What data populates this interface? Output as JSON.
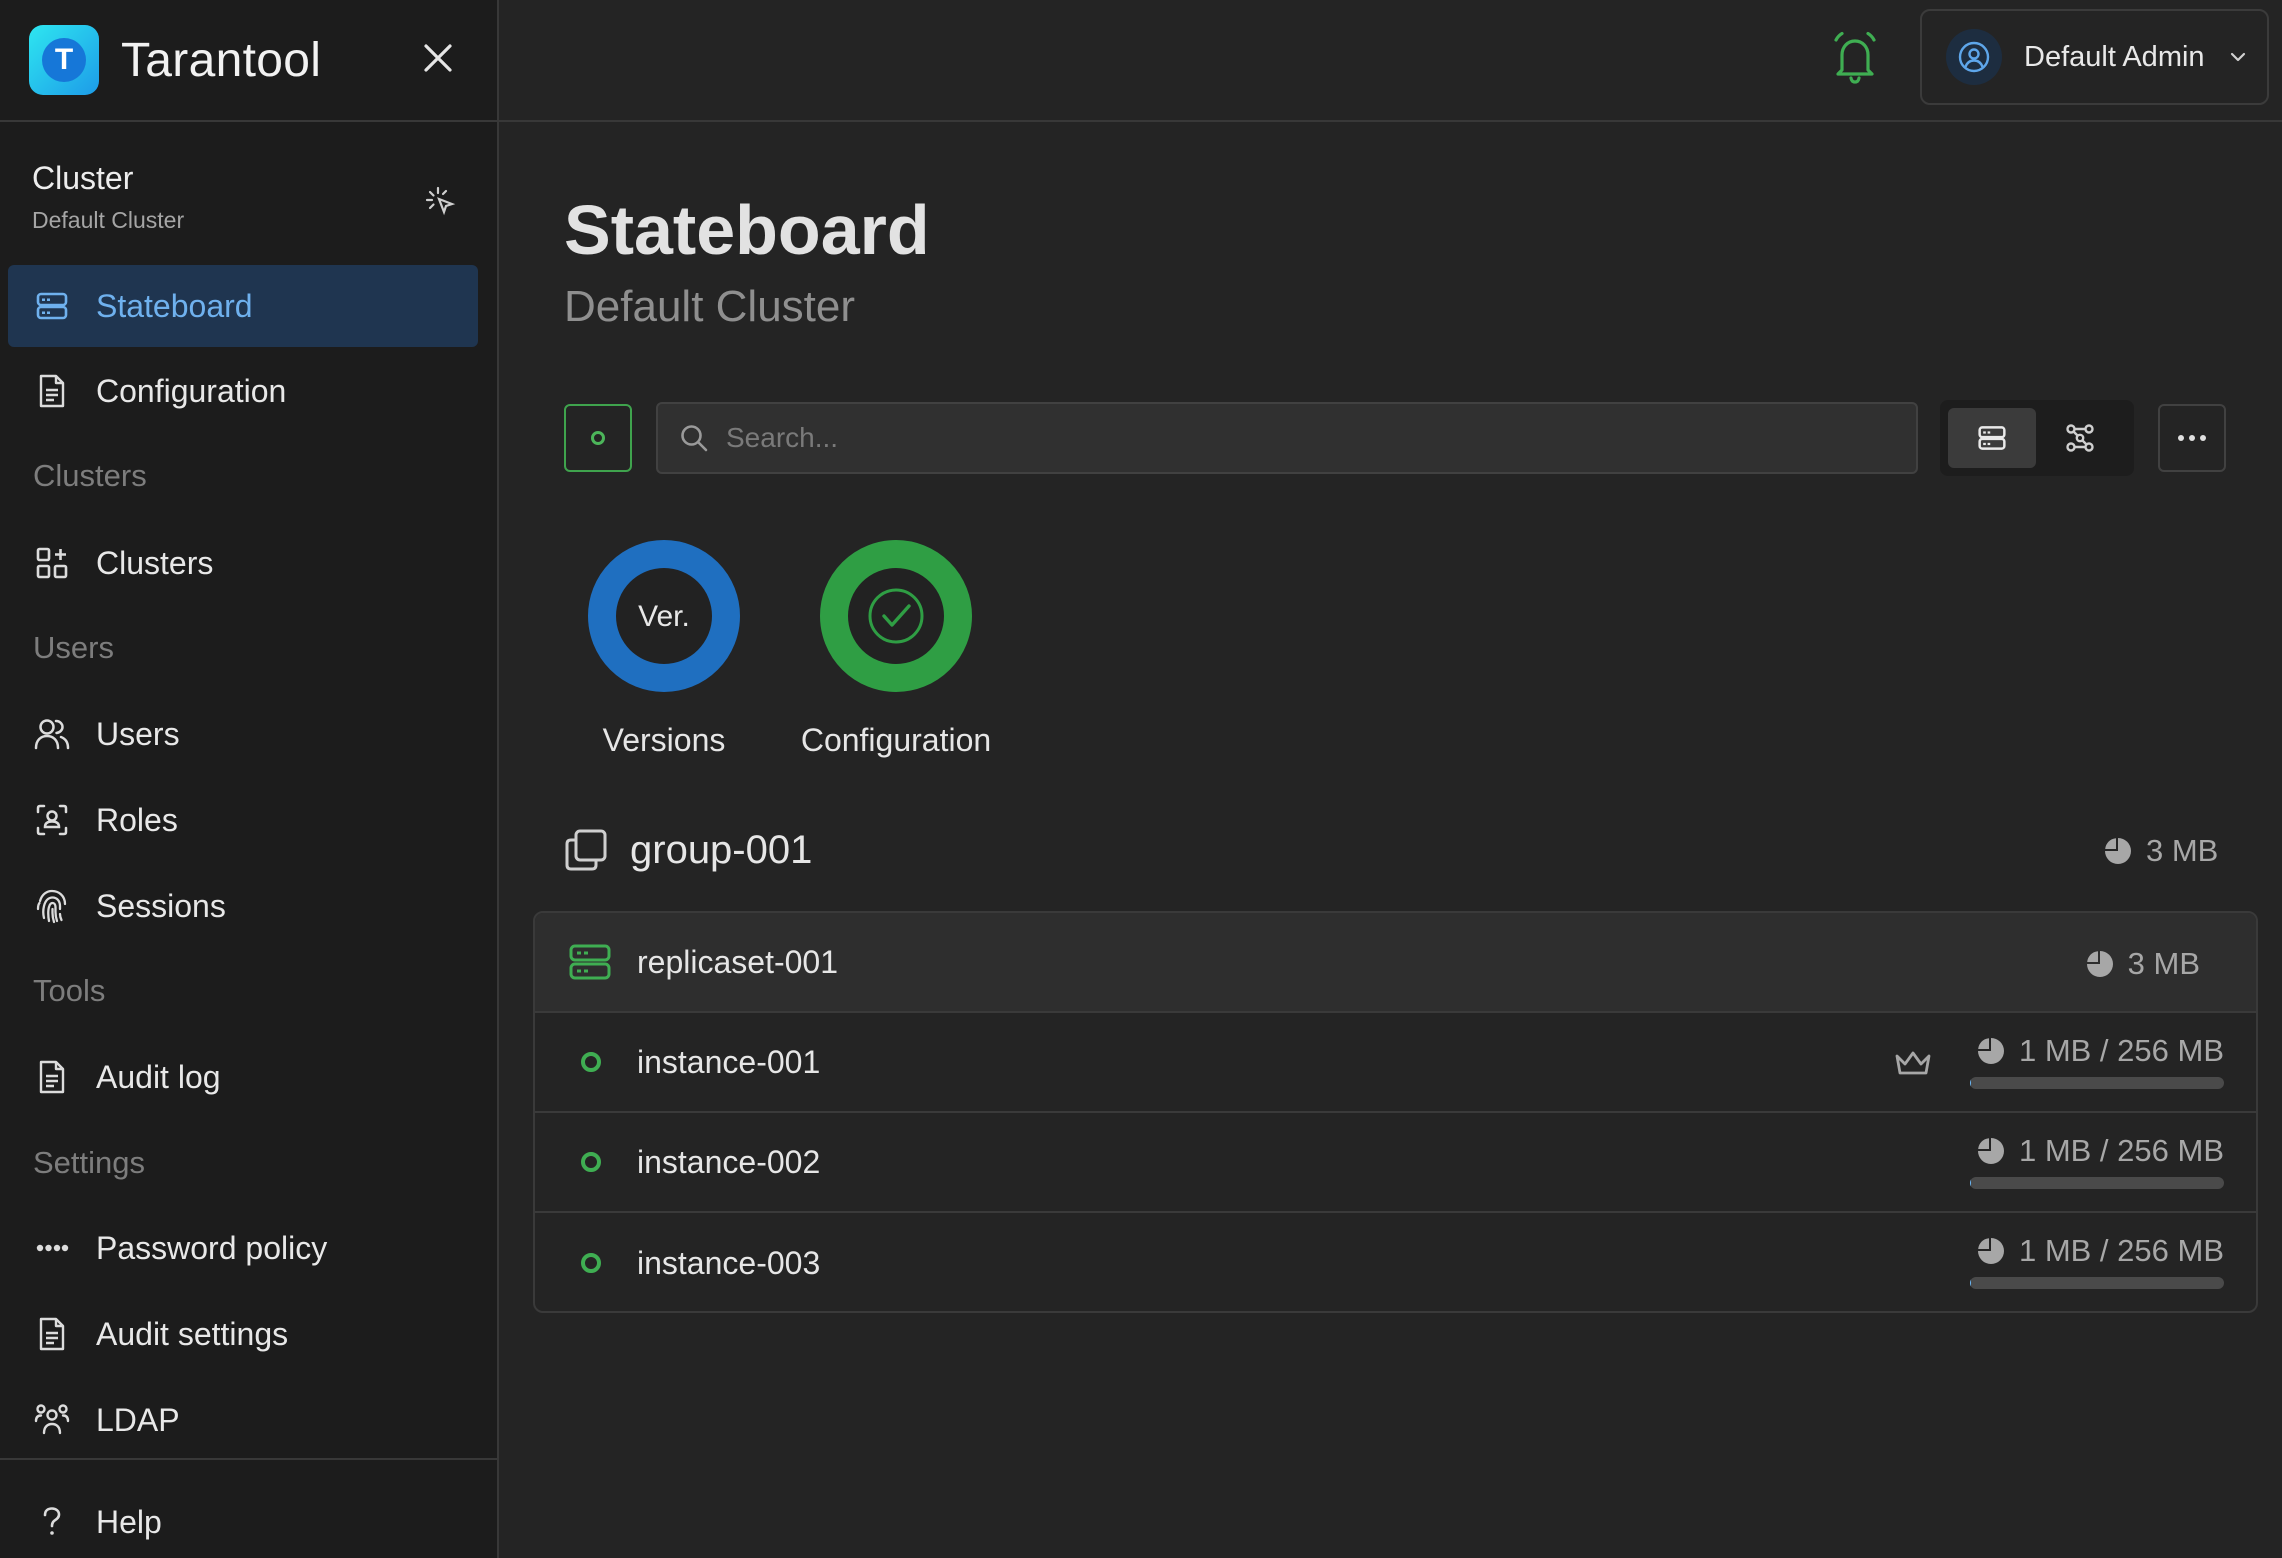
{
  "brand": {
    "name": "Tarantool",
    "logo_letter": "T"
  },
  "sidebar": {
    "cluster_title": "Cluster",
    "cluster_name": "Default Cluster",
    "sections": {
      "clusters": "Clusters",
      "users": "Users",
      "tools": "Tools",
      "settings": "Settings"
    },
    "items": {
      "stateboard": "Stateboard",
      "configuration": "Configuration",
      "clusters": "Clusters",
      "users": "Users",
      "roles": "Roles",
      "sessions": "Sessions",
      "audit_log": "Audit log",
      "password_policy": "Password policy",
      "audit_settings": "Audit settings",
      "ldap": "LDAP",
      "help": "Help"
    }
  },
  "topbar": {
    "user_name": "Default Admin"
  },
  "main": {
    "title": "Stateboard",
    "subtitle": "Default Cluster",
    "search_placeholder": "Search...",
    "status": {
      "versions_ring_text": "Ver.",
      "versions_label": "Versions",
      "configuration_label": "Configuration"
    },
    "group": {
      "name": "group-001",
      "size": "3 MB",
      "replicaset": {
        "name": "replicaset-001",
        "size": "3 MB",
        "instances": [
          {
            "name": "instance-001",
            "memory": "1 MB / 256 MB",
            "usage_fraction": 0.004,
            "leader": true
          },
          {
            "name": "instance-002",
            "memory": "1 MB / 256 MB",
            "usage_fraction": 0.004,
            "leader": false
          },
          {
            "name": "instance-003",
            "memory": "1 MB / 256 MB",
            "usage_fraction": 0.004,
            "leader": false
          }
        ]
      }
    }
  },
  "colors": {
    "accent_blue": "#1f6fc0",
    "status_green": "#3fae52",
    "active_nav_bg": "#1f3550",
    "bell_green": "#3fae52"
  }
}
